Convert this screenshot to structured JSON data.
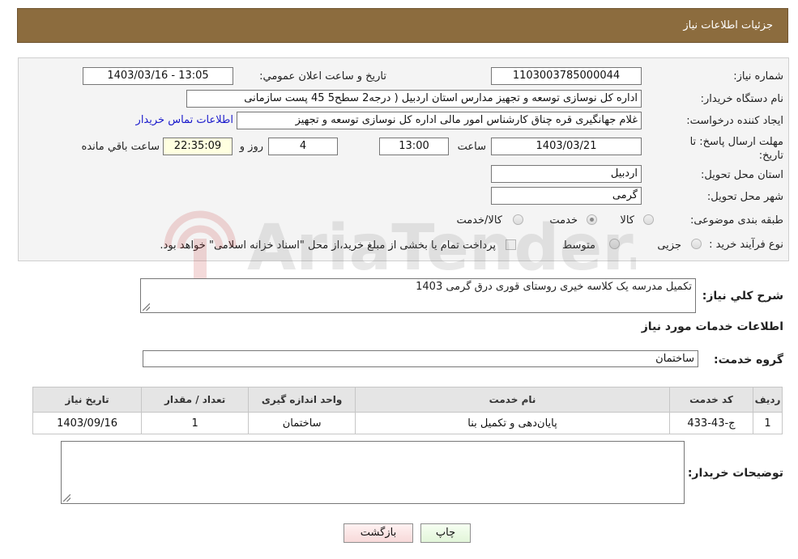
{
  "header": {
    "title": "جزئیات اطلاعات نیاز"
  },
  "form": {
    "need_number": {
      "label": "شماره نیاز:",
      "value": "1103003785000044"
    },
    "announce_datetime": {
      "label": "تاریخ و ساعت اعلان عمومي:",
      "value": "1403/03/16 - 13:05"
    },
    "buyer_org": {
      "label": "نام دستگاه خریدار:",
      "value": "اداره کل نوسازی   توسعه و تجهیز مدارس استان اردبیل ( درجه2  سطح5  45 پست سازمانی"
    },
    "requester": {
      "label": "ایجاد کننده درخواست:",
      "value": "غلام جهانگیری قره چناق کارشناس امور مالی اداره کل نوسازی   توسعه و تجهیز",
      "contact_link": "اطلاعات تماس خریدار"
    },
    "deadline": {
      "label": "مهلت ارسال پاسخ: تا تاریخ:",
      "date": "1403/03/21",
      "time_label": "ساعت",
      "time": "13:00",
      "days": "4",
      "days_label": "روز و",
      "remaining": "22:35:09",
      "remaining_label": "ساعت باقي مانده"
    },
    "province": {
      "label": "استان محل تحویل:",
      "value": "اردبیل"
    },
    "city": {
      "label": "شهر محل تحویل:",
      "value": "گرمی"
    },
    "category": {
      "label": "طبقه بندی موضوعی:",
      "options": [
        "کالا",
        "خدمت",
        "کالا/خدمت"
      ],
      "selected": "خدمت"
    },
    "purchase_type": {
      "label": "نوع فرآیند خرید :",
      "options": [
        "جزیی",
        "متوسط"
      ],
      "note": "پرداخت تمام یا بخشی از مبلغ خرید،از محل \"اسناد خزانه اسلامی\" خواهد بود."
    }
  },
  "summary": {
    "label": "شرح کلي نیاز:",
    "value": "تکمیل مدرسه یک کلاسه خیری روستای قوری درق گرمی 1403"
  },
  "services_section": {
    "title": "اطلاعات خدمات مورد نیاز",
    "group_label": "گروه خدمت:",
    "group_value": "ساختمان"
  },
  "table": {
    "headers": [
      "ردیف",
      "کد خدمت",
      "نام خدمت",
      "واحد اندازه گیری",
      "تعداد / مقدار",
      "تاریخ نیاز"
    ],
    "rows": [
      [
        "1",
        "ج-43-433",
        "پایان‌دهی و تکمیل بنا",
        "ساختمان",
        "1",
        "1403/09/16"
      ]
    ]
  },
  "buyer_notes": {
    "label": "توضیحات خریدار:",
    "value": ""
  },
  "buttons": {
    "print": "چاپ",
    "back": "بازگشت"
  },
  "watermark": {
    "text": "AriaTender.neT"
  }
}
